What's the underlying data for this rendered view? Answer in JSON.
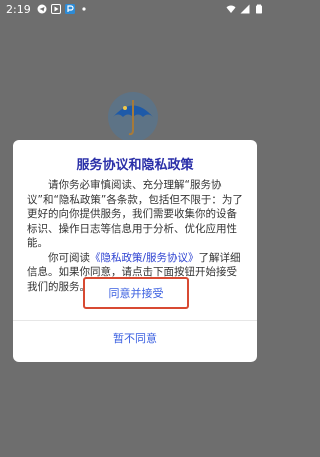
{
  "status_bar": {
    "time": "2:19"
  },
  "dialog": {
    "title": "服务协议和隐私政策",
    "para1": "请你务必审慎阅读、充分理解“服务协议”和“隐私政策”各条款，包括但不限于：为了更好的向你提供服务，我们需要收集你的设备标识、操作日志等信息用于分析、优化应用性能。",
    "para2_prefix": "你可阅读",
    "para2_link": "《隐私政策/服务协议》",
    "para2_suffix": "了解详细信息。如果你同意，请点击下面按钮开始接受我们的服务。",
    "accept_label": "同意并接受",
    "decline_label": "暂不同意"
  },
  "colors": {
    "title": "#2a2fa8",
    "link": "#2a3fd1",
    "button_text": "#3a5fe0",
    "highlight_border": "#d84a32",
    "overlay": "#6e6e6e"
  }
}
